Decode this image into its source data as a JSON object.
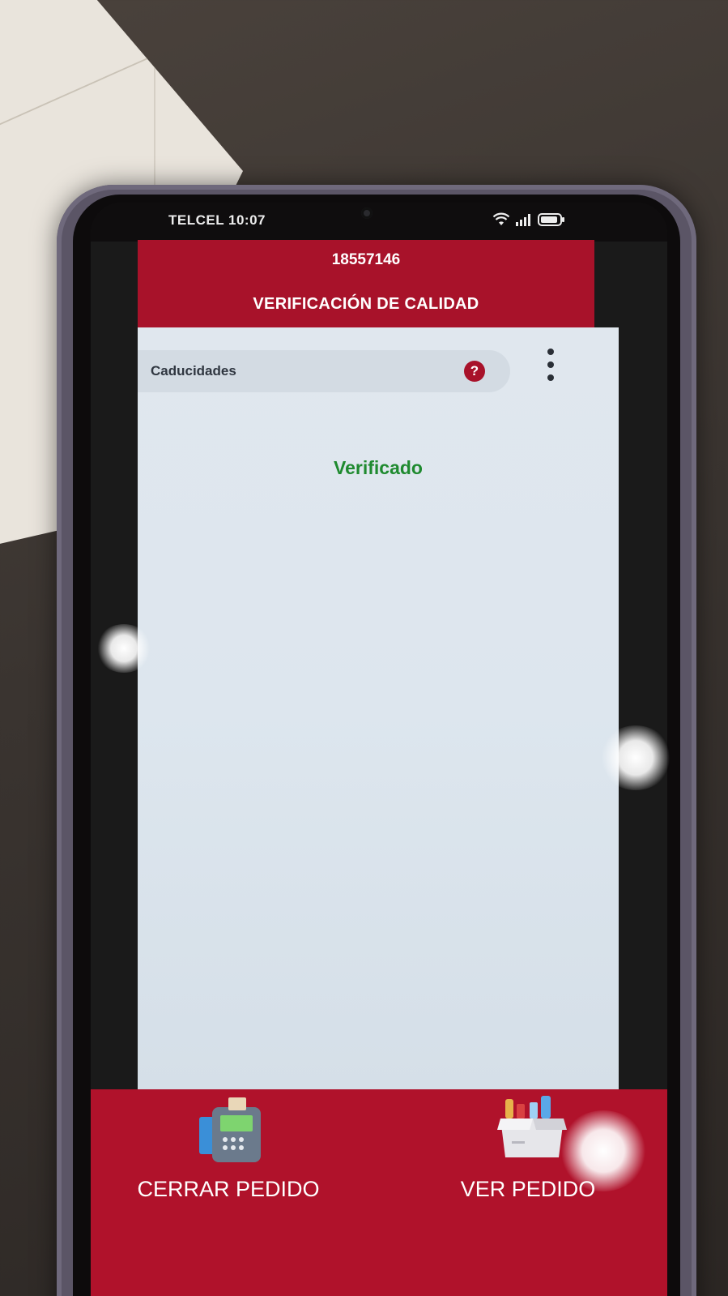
{
  "status_bar": {
    "carrier_time": "TELCEL 10:07"
  },
  "header": {
    "order_number": "18557146",
    "title": "VERIFICACIÓN DE CALIDAD"
  },
  "section": {
    "label": "Caducidades",
    "help_symbol": "?"
  },
  "main": {
    "status_text": "Verificado",
    "status_color": "#1f8a2f"
  },
  "bottom_bar": {
    "close_order_label": "CERRAR PEDIDO",
    "view_order_label": "VER PEDIDO"
  },
  "colors": {
    "brand_red": "#a8122a",
    "background": "#dde6ee"
  },
  "icons": {
    "wifi": "wifi-icon",
    "signal": "signal-icon",
    "battery": "battery-icon",
    "help": "help-icon",
    "more": "more-vertical-icon",
    "pos_terminal": "pos-terminal-icon",
    "grocery_box": "grocery-box-icon"
  }
}
